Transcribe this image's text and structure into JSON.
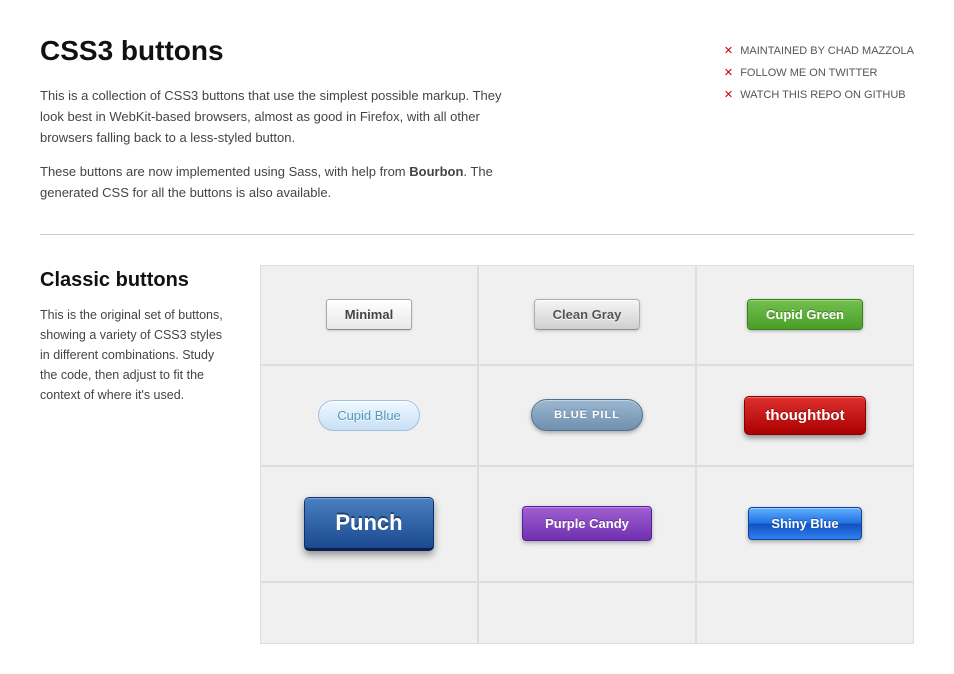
{
  "page": {
    "title": "CSS3 buttons",
    "description1": "This is a collection of CSS3 buttons that use the simplest possible markup. They look best in WebKit-based browsers, almost as good in Firefox, with all other browsers falling back to a less-styled button.",
    "description2_prefix": "These buttons are now implemented using Sass, with help from ",
    "description2_bold": "Bourbon",
    "description2_suffix": ". The generated CSS for all the buttons is also available."
  },
  "header_links": [
    {
      "label": "MAINTAINED BY CHAD MAZZOLA"
    },
    {
      "label": "FOLLOW ME ON TWITTER"
    },
    {
      "label": "WATCH THIS REPO ON GITHUB"
    }
  ],
  "classic": {
    "title": "Classic buttons",
    "description": "This is the original set of buttons, showing a variety of CSS3 styles in different combinations. Study the code, then adjust to fit the context of where it's used."
  },
  "buttons": [
    {
      "label": "Minimal",
      "style": "minimal"
    },
    {
      "label": "Clean Gray",
      "style": "clean-gray"
    },
    {
      "label": "Cupid Green",
      "style": "cupid-green"
    },
    {
      "label": "Cupid Blue",
      "style": "cupid-blue"
    },
    {
      "label": "BLUE PILL",
      "style": "blue-pill"
    },
    {
      "label": "thoughtbot",
      "style": "thoughtbot"
    },
    {
      "label": "Punch",
      "style": "punch"
    },
    {
      "label": "Purple Candy",
      "style": "purple-candy"
    },
    {
      "label": "Shiny Blue",
      "style": "shiny-blue"
    }
  ]
}
